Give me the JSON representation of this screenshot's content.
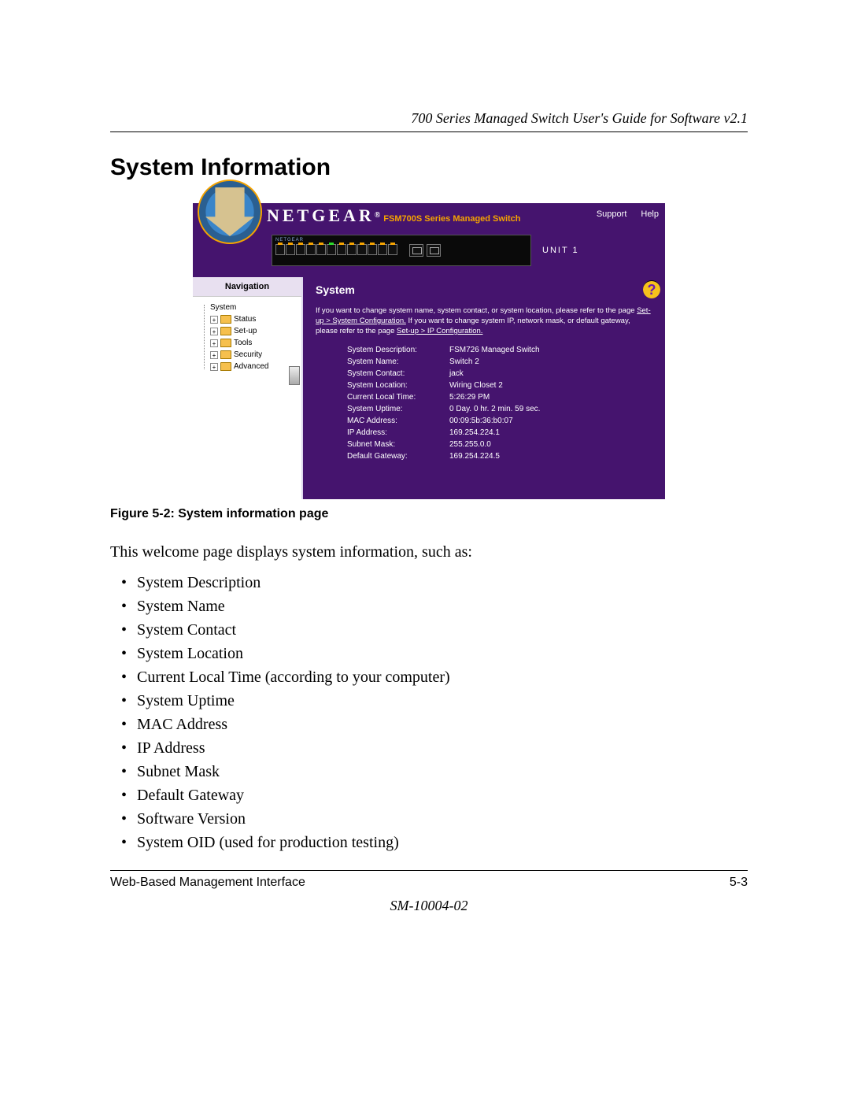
{
  "header": {
    "guide_title": "700 Series Managed Switch User's Guide for Software v2.1"
  },
  "section": {
    "title": "System Information"
  },
  "screenshot": {
    "brand": "NETGEAR",
    "brand_reg": "®",
    "subtitle": "FSM700S Series Managed Switch",
    "links": {
      "support": "Support",
      "help": "Help"
    },
    "device_label": "NETGEAR",
    "unit_label": "UNIT 1",
    "sidebar": {
      "title": "Navigation",
      "items": [
        {
          "label": "System",
          "type": "root"
        },
        {
          "label": "Status",
          "type": "folder"
        },
        {
          "label": "Set-up",
          "type": "folder"
        },
        {
          "label": "Tools",
          "type": "folder"
        },
        {
          "label": "Security",
          "type": "folder"
        },
        {
          "label": "Advanced",
          "type": "folder"
        }
      ]
    },
    "main": {
      "heading": "System",
      "intro_pre": "If you want to change system name, system contact, or system location, please refer to the page ",
      "intro_link1": "Set-up > System Configuration.",
      "intro_mid": " If you want to change system IP, network mask, or default gateway, please refer to the page ",
      "intro_link2": "Set-up > IP Configuration.",
      "rows": [
        {
          "k": "System Description:",
          "v": "FSM726 Managed Switch"
        },
        {
          "k": "System Name:",
          "v": "Switch 2"
        },
        {
          "k": "System Contact:",
          "v": "jack"
        },
        {
          "k": "System Location:",
          "v": "Wiring Closet 2"
        },
        {
          "k": "Current Local Time:",
          "v": "5:26:29 PM"
        },
        {
          "k": "System Uptime:",
          "v": "0 Day. 0 hr. 2 min. 59 sec."
        },
        {
          "k": "MAC Address:",
          "v": "00:09:5b:36:b0:07"
        },
        {
          "k": "IP Address:",
          "v": "169.254.224.1"
        },
        {
          "k": "Subnet Mask:",
          "v": "255.255.0.0"
        },
        {
          "k": "Default Gateway:",
          "v": "169.254.224.5"
        }
      ],
      "help_icon": "?"
    }
  },
  "caption": "Figure 5-2:  System information page",
  "body_text": "This welcome page displays system information, such as:",
  "bullets": [
    "System Description",
    "System Name",
    "System Contact",
    "System Location",
    "Current Local Time (according to your computer)",
    "System Uptime",
    "MAC Address",
    "IP Address",
    "Subnet Mask",
    "Default Gateway",
    "Software Version",
    "System OID (used for production testing)"
  ],
  "footer": {
    "left": "Web-Based Management Interface",
    "right": "5-3",
    "doc_code": "SM-10004-02"
  }
}
